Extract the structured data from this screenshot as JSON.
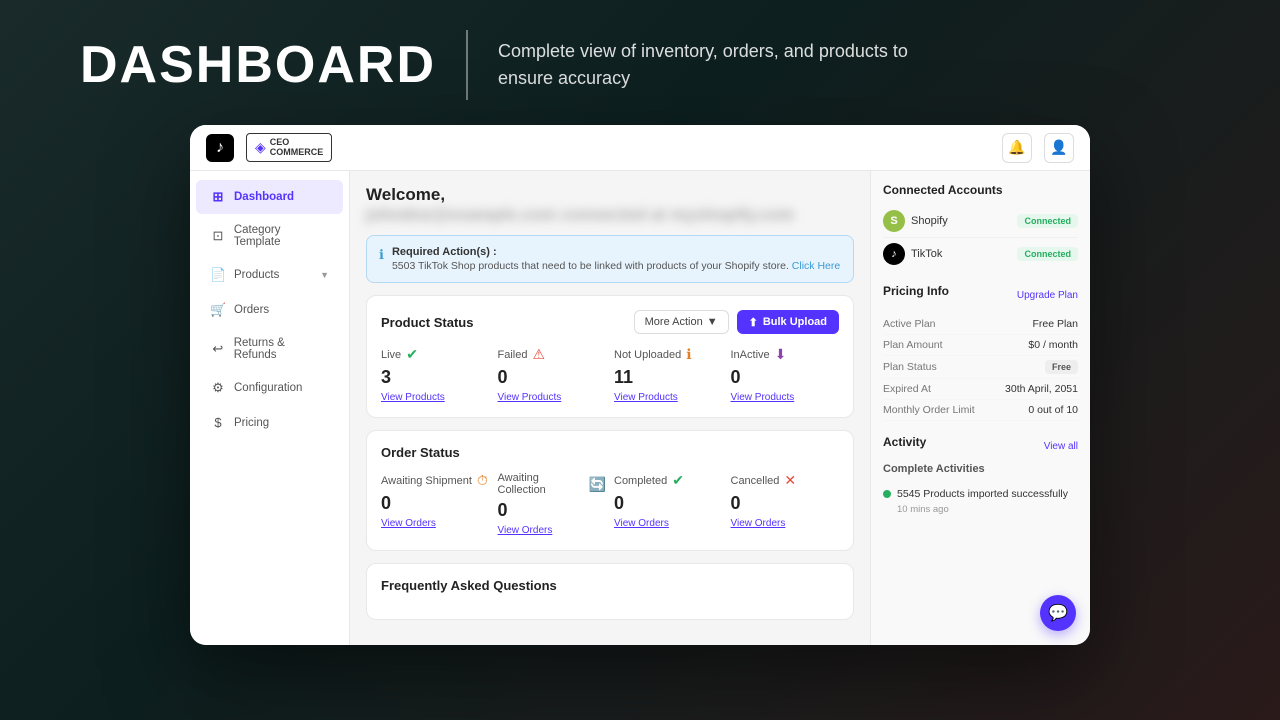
{
  "banner": {
    "title": "DASHBOARD",
    "subtitle": "Complete view of inventory, orders, and products to ensure accuracy",
    "divider": true
  },
  "topbar": {
    "brand_name_line1": "CEO",
    "brand_name_line2": "COMMERCE",
    "notification_icon": "🔔",
    "user_icon": "👤"
  },
  "sidebar": {
    "items": [
      {
        "id": "dashboard",
        "label": "Dashboard",
        "icon": "⊞",
        "active": true
      },
      {
        "id": "category-template",
        "label": "Category Template",
        "icon": "⊡"
      },
      {
        "id": "products",
        "label": "Products",
        "icon": "📄",
        "hasArrow": true
      },
      {
        "id": "orders",
        "label": "Orders",
        "icon": "🛒"
      },
      {
        "id": "returns-refunds",
        "label": "Returns & Refunds",
        "icon": "↩"
      },
      {
        "id": "configuration",
        "label": "Configuration",
        "icon": "⚙"
      },
      {
        "id": "pricing",
        "label": "Pricing",
        "icon": "$"
      }
    ]
  },
  "main": {
    "welcome_prefix": "Welcome,",
    "welcome_blurred": "johndoe@example.com connected at myshopify.com",
    "alert": {
      "title": "Required Action(s) :",
      "description": "5503 TikTok Shop products that need to be linked with products of your Shopify store.",
      "link_text": "Click Here"
    },
    "product_status": {
      "title": "Product Status",
      "more_action_label": "More Action",
      "bulk_upload_label": "Bulk Upload",
      "statuses": [
        {
          "id": "live",
          "name": "Live",
          "icon": "✓",
          "icon_color": "green",
          "count": "3",
          "link": "View Products"
        },
        {
          "id": "failed",
          "name": "Failed",
          "icon": "⚠",
          "icon_color": "red",
          "count": "0",
          "link": "View Products"
        },
        {
          "id": "not-uploaded",
          "name": "Not Uploaded",
          "icon": "ℹ",
          "icon_color": "orange",
          "count": "11",
          "link": "View Products"
        },
        {
          "id": "inactive",
          "name": "InActive",
          "icon": "↓",
          "icon_color": "purple",
          "count": "0",
          "link": "View Products"
        }
      ]
    },
    "order_status": {
      "title": "Order Status",
      "statuses": [
        {
          "id": "awaiting-shipment",
          "name": "Awaiting Shipment",
          "icon": "⏱",
          "icon_color": "orange",
          "count": "0",
          "link": "View Orders"
        },
        {
          "id": "awaiting-collection",
          "name": "Awaiting Collection",
          "icon": "🔄",
          "icon_color": "orange",
          "count": "0",
          "link": "View Orders"
        },
        {
          "id": "completed",
          "name": "Completed",
          "icon": "✓",
          "icon_color": "green",
          "count": "0",
          "link": "View Orders"
        },
        {
          "id": "cancelled",
          "name": "Cancelled",
          "icon": "✕",
          "icon_color": "red",
          "count": "0",
          "link": "View Orders"
        }
      ]
    },
    "faq_title": "Frequently Asked Questions"
  },
  "right_panel": {
    "connected_accounts": {
      "title": "Connected Accounts",
      "accounts": [
        {
          "id": "shopify",
          "name": "Shopify",
          "status": "Connected"
        },
        {
          "id": "tiktok",
          "name": "TikTok",
          "status": "Connected"
        }
      ]
    },
    "pricing_info": {
      "title": "Pricing Info",
      "upgrade_label": "Upgrade Plan",
      "rows": [
        {
          "label": "Active Plan",
          "value": "Free Plan",
          "badge": null
        },
        {
          "label": "Plan Amount",
          "value": "$0 / month",
          "badge": null
        },
        {
          "label": "Plan Status",
          "value": null,
          "badge": "Free"
        },
        {
          "label": "Expired At",
          "value": "30th April, 2051",
          "badge": null
        },
        {
          "label": "Monthly Order Limit",
          "value": "0 out of 10",
          "badge": null
        }
      ]
    },
    "activity": {
      "title": "Activity",
      "view_all_label": "View all",
      "sub_title": "Complete Activities",
      "items": [
        {
          "text": "5545 Products imported successfully",
          "time": "10 mins ago",
          "status": "success"
        }
      ]
    }
  },
  "chat_button": {
    "icon": "💬",
    "label": "Chat"
  }
}
